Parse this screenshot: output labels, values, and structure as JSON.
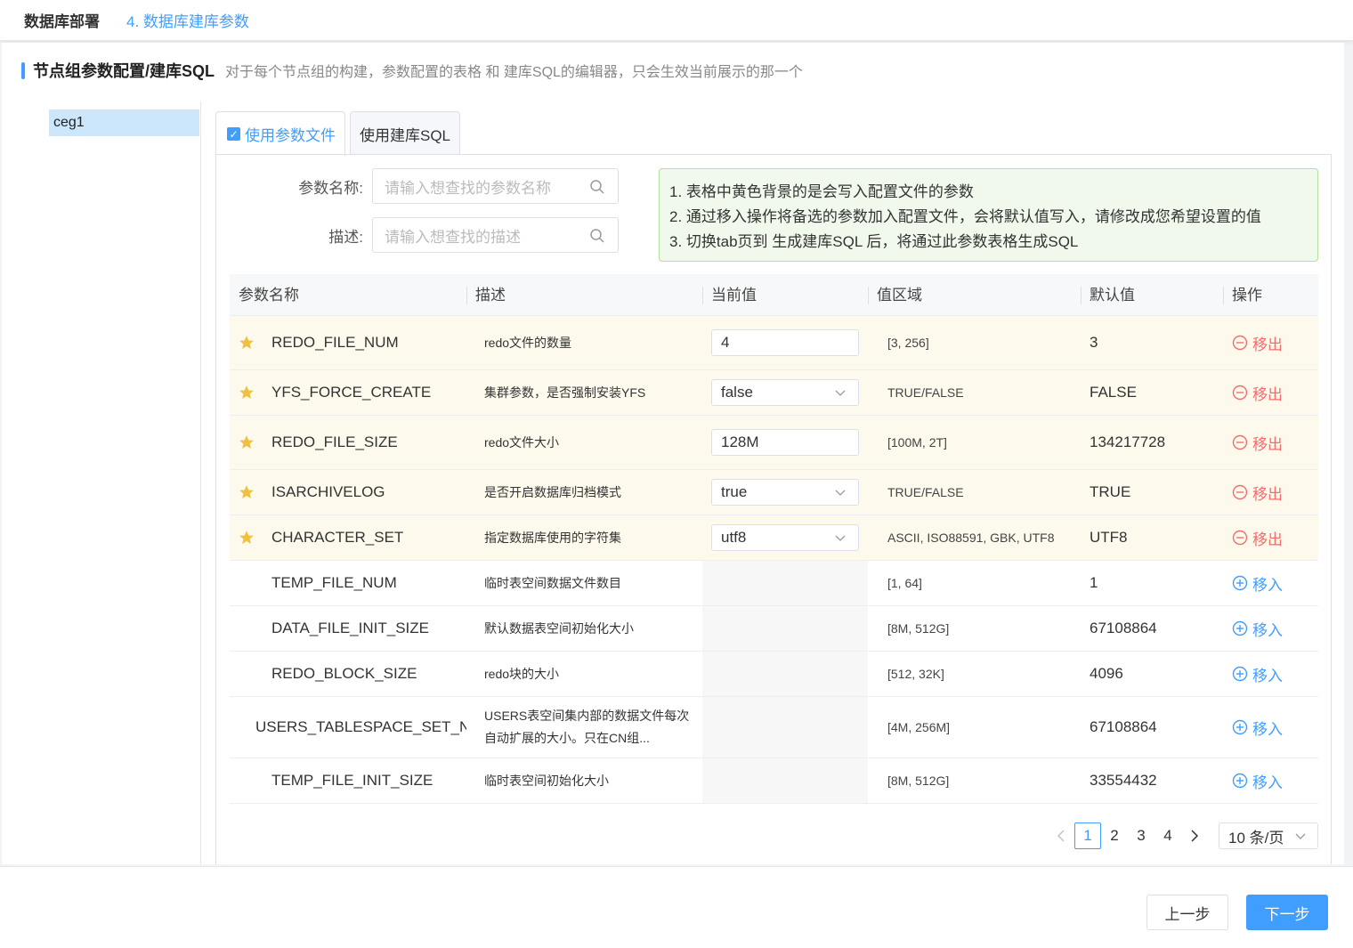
{
  "breadcrumb": {
    "root": "数据库部署",
    "current": "4. 数据库建库参数"
  },
  "section": {
    "title": "节点组参数配置/建库SQL",
    "description": "对于每个节点组的构建，参数配置的表格 和 建库SQL的编辑器，只会生效当前展示的那一个"
  },
  "node_groups": [
    {
      "label": "ceg1",
      "selected": true
    }
  ],
  "tabs": [
    {
      "label": "使用参数文件",
      "active": true,
      "checked": true
    },
    {
      "label": "使用建库SQL",
      "active": false
    }
  ],
  "filters": {
    "name": {
      "label": "参数名称:",
      "placeholder": "请输入想查找的参数名称"
    },
    "desc": {
      "label": "描述:",
      "placeholder": "请输入想查找的描述"
    }
  },
  "tips": [
    "1. 表格中黄色背景的是会写入配置文件的参数",
    "2. 通过移入操作将备选的参数加入配置文件，会将默认值写入，请修改成您希望设置的值",
    "3. 切换tab页到 生成建库SQL 后，将通过此参数表格生成SQL"
  ],
  "table": {
    "headers": [
      "参数名称",
      "描述",
      "当前值",
      "值区域",
      "默认值",
      "操作"
    ],
    "rows": [
      {
        "name": "REDO_FILE_NUM",
        "desc": "redo文件的数量",
        "current": "4",
        "input": "text",
        "range": "[3, 256]",
        "default": "3",
        "op": "移出",
        "starred": true
      },
      {
        "name": "YFS_FORCE_CREATE",
        "desc": "集群参数，是否强制安装YFS",
        "current": "false",
        "input": "select",
        "range": "TRUE/FALSE",
        "default": "FALSE",
        "op": "移出",
        "starred": true
      },
      {
        "name": "REDO_FILE_SIZE",
        "desc": "redo文件大小",
        "current": "128M",
        "input": "text",
        "range": "[100M, 2T]",
        "default": "134217728",
        "op": "移出",
        "starred": true
      },
      {
        "name": "ISARCHIVELOG",
        "desc": "是否开启数据库归档模式",
        "current": "true",
        "input": "select",
        "range": "TRUE/FALSE",
        "default": "TRUE",
        "op": "移出",
        "starred": true
      },
      {
        "name": "CHARACTER_SET",
        "desc": "指定数据库使用的字符集",
        "current": "utf8",
        "input": "select",
        "range": "ASCII, ISO88591, GBK, UTF8",
        "default": "UTF8",
        "op": "移出",
        "starred": true
      },
      {
        "name": "TEMP_FILE_NUM",
        "desc": "临时表空间数据文件数目",
        "current": "",
        "input": "none",
        "range": "[1, 64]",
        "default": "1",
        "op": "移入",
        "starred": false
      },
      {
        "name": "DATA_FILE_INIT_SIZE",
        "desc": "默认数据表空间初始化大小",
        "current": "",
        "input": "none",
        "range": "[8M, 512G]",
        "default": "67108864",
        "op": "移入",
        "starred": false
      },
      {
        "name": "REDO_BLOCK_SIZE",
        "desc": "redo块的大小",
        "current": "",
        "input": "none",
        "range": "[512, 32K]",
        "default": "4096",
        "op": "移入",
        "starred": false
      },
      {
        "name": "USERS_TABLESPACE_SET_NEXT_SIZE",
        "desc": "USERS表空间集内部的数据文件每次自动扩展的大小。只在CN组...",
        "current": "",
        "input": "none",
        "range": "[4M, 256M]",
        "default": "67108864",
        "op": "移入",
        "starred": false
      },
      {
        "name": "TEMP_FILE_INIT_SIZE",
        "desc": "临时表空间初始化大小",
        "current": "",
        "input": "none",
        "range": "[8M, 512G]",
        "default": "33554432",
        "op": "移入",
        "starred": false
      }
    ]
  },
  "pagination": {
    "pages": [
      "1",
      "2",
      "3",
      "4"
    ],
    "current": "1",
    "page_size": "10 条/页"
  },
  "footer": {
    "prev": "上一步",
    "next": "下一步"
  },
  "colors": {
    "accent": "#409eff",
    "danger": "#f56c6c",
    "starred_row": "#fdf9ec",
    "star": "#f0c040",
    "tips_bg": "#f0f9eb"
  }
}
